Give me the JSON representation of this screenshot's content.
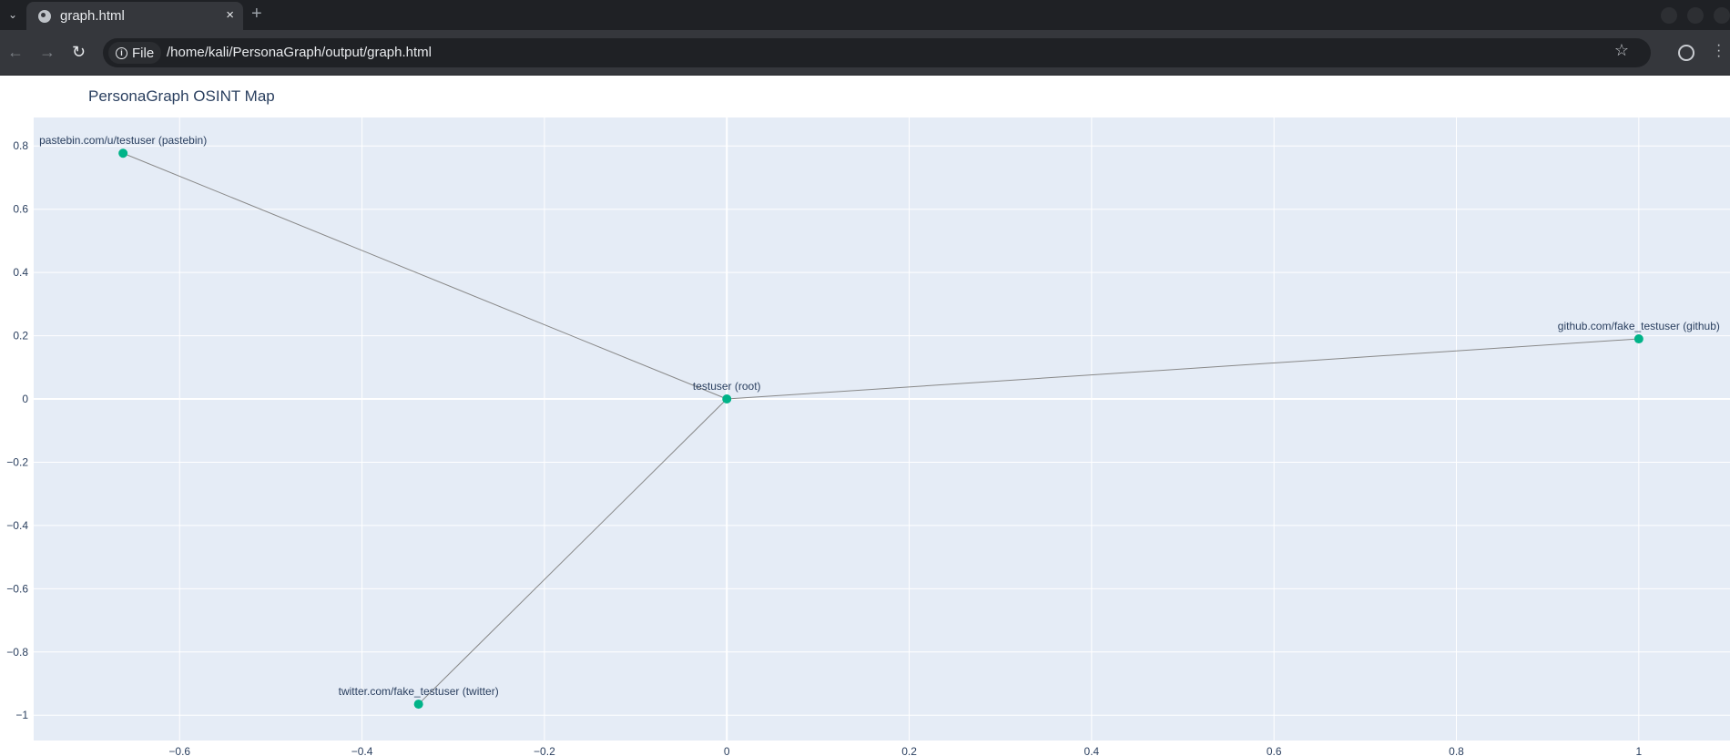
{
  "browser": {
    "tab_title": "graph.html",
    "new_tab_symbol": "+",
    "close_symbol": "×",
    "info_label": "File",
    "url": "/home/kali/PersonaGraph/output/graph.html"
  },
  "page": {
    "title": "PersonaGraph OSINT Map"
  },
  "chart_data": {
    "type": "scatter",
    "title": "PersonaGraph OSINT Map",
    "xlabel": "",
    "ylabel": "",
    "xlim": [
      -0.76,
      1.1
    ],
    "ylim": [
      -1.08,
      0.89
    ],
    "x_ticks": [
      -0.6,
      -0.4,
      -0.2,
      0,
      0.2,
      0.4,
      0.6,
      0.8,
      1
    ],
    "y_ticks": [
      0.8,
      0.6,
      0.4,
      0.2,
      0,
      -0.2,
      -0.4,
      -0.6,
      -0.8,
      -1
    ],
    "x_tick_labels": [
      "−0.6",
      "−0.4",
      "−0.2",
      "0",
      "0.2",
      "0.4",
      "0.6",
      "0.8",
      "1"
    ],
    "y_tick_labels": [
      "0.8",
      "0.6",
      "0.4",
      "0.2",
      "0",
      "−0.2",
      "−0.4",
      "−0.6",
      "−0.8",
      "−1"
    ],
    "grid": true,
    "marker_color": "#00b388",
    "edge_color": "#888888",
    "background_color": "#e5ecf6",
    "nodes": [
      {
        "label": "testuser (root)",
        "x": 0,
        "y": 0
      },
      {
        "label": "pastebin.com/u/testuser (pastebin)",
        "x": -0.662,
        "y": 0.777
      },
      {
        "label": "github.com/fake_testuser (github)",
        "x": 1.0,
        "y": 0.19
      },
      {
        "label": "twitter.com/fake_testuser (twitter)",
        "x": -0.338,
        "y": -0.965
      }
    ],
    "edges": [
      [
        0,
        1
      ],
      [
        0,
        2
      ],
      [
        0,
        3
      ]
    ]
  }
}
